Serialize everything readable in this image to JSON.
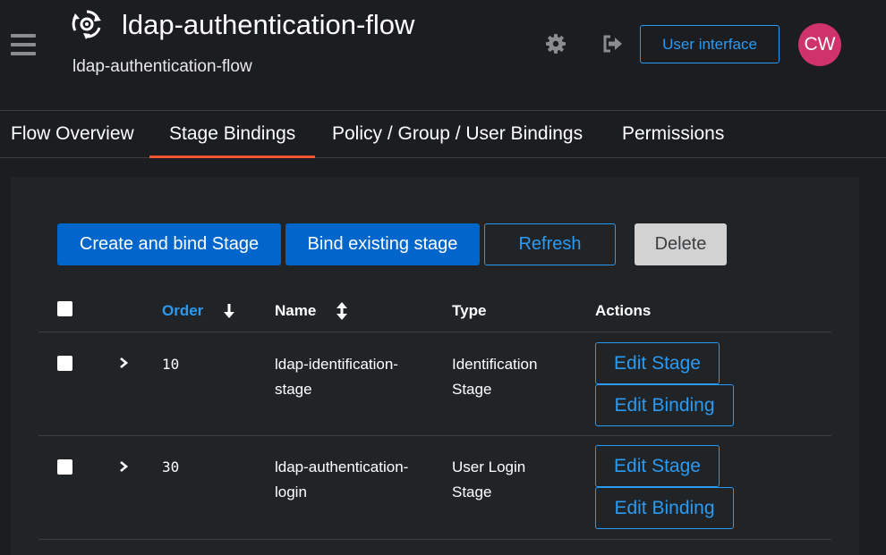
{
  "header": {
    "title": "ldap-authentication-flow",
    "subtitle": "ldap-authentication-flow",
    "user_interface_label": "User interface",
    "avatar_initials": "CW",
    "icons": {
      "menu": "hamburger-icon",
      "flow": "flow-icon",
      "settings": "gear-icon",
      "logout": "logout-icon"
    }
  },
  "tabs": [
    {
      "label": "Flow Overview",
      "active": false
    },
    {
      "label": "Stage Bindings",
      "active": true
    },
    {
      "label": "Policy / Group / User Bindings",
      "active": false
    },
    {
      "label": "Permissions",
      "active": false
    }
  ],
  "toolbar": {
    "create_bind_label": "Create and bind Stage",
    "bind_existing_label": "Bind existing stage",
    "refresh_label": "Refresh",
    "delete_label": "Delete"
  },
  "table": {
    "columns": {
      "order": "Order",
      "name": "Name",
      "type": "Type",
      "actions": "Actions"
    },
    "rows": [
      {
        "order": "10",
        "name": [
          "ldap-identification-",
          "stage"
        ],
        "type": [
          "Identification",
          "Stage"
        ],
        "edit_stage": "Edit Stage",
        "edit_binding": "Edit Binding"
      },
      {
        "order": "30",
        "name": [
          "ldap-authentication-",
          "login"
        ],
        "type": [
          "User Login",
          "Stage"
        ],
        "edit_stage": "Edit Stage",
        "edit_binding": "Edit Binding"
      }
    ]
  },
  "colors": {
    "background": "#1b1d21",
    "card": "#212427",
    "primary": "#0066cc",
    "link": "#2b9af3",
    "active_tab": "#ee5533",
    "avatar": "#d0336a"
  }
}
